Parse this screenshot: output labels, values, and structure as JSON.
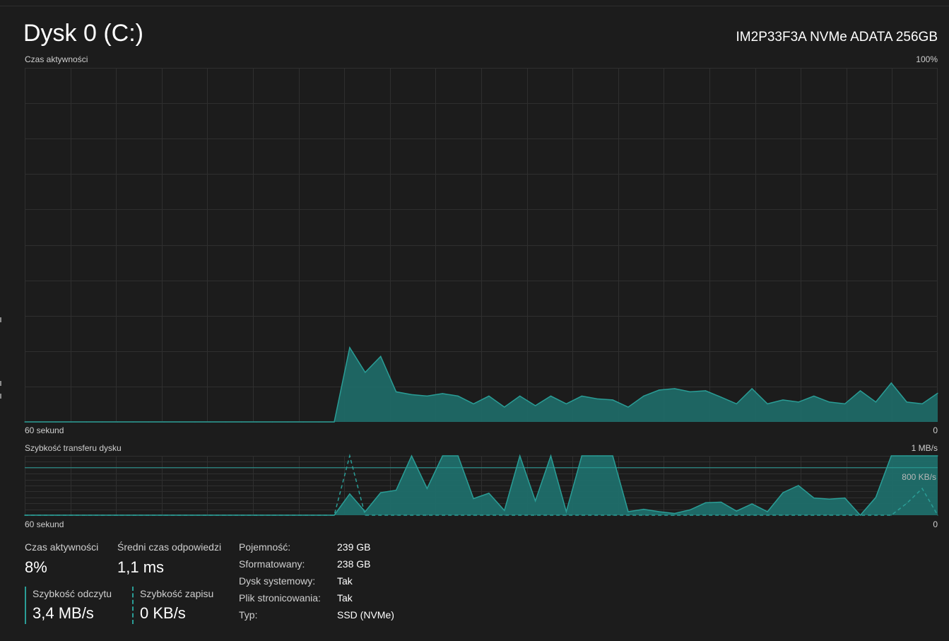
{
  "header": {
    "title": "Dysk 0 (C:)",
    "model": "IM2P33F3A NVMe ADATA 256GB"
  },
  "activity_chart": {
    "label": "Czas aktywności",
    "max_label": "100%",
    "x_left_label": "60 sekund",
    "x_right_label": "0"
  },
  "transfer_chart": {
    "label": "Szybkość transferu dysku",
    "max_label": "1 MB/s",
    "ref_label": "800 KB/s",
    "x_left_label": "60 sekund",
    "x_right_label": "0"
  },
  "stats": {
    "active_time": {
      "label": "Czas aktywności",
      "value": "8%"
    },
    "avg_response": {
      "label": "Średni czas odpowiedzi",
      "value": "1,1 ms"
    },
    "read_speed": {
      "label": "Szybkość odczytu",
      "value": "3,4 MB/s"
    },
    "write_speed": {
      "label": "Szybkość zapisu",
      "value": "0 KB/s"
    }
  },
  "properties": [
    {
      "label": "Pojemność:",
      "value": "239 GB"
    },
    {
      "label": "Sformatowany:",
      "value": "238 GB"
    },
    {
      "label": "Dysk systemowy:",
      "value": "Tak"
    },
    {
      "label": "Plik stronicowania:",
      "value": "Tak"
    },
    {
      "label": "Typ:",
      "value": "SSD (NVMe)"
    }
  ],
  "colors": {
    "accent": "#2a9d96",
    "fill": "#1f6e6a",
    "grid": "#2f2f2f",
    "background": "#1c1c1c"
  },
  "chart_data": [
    {
      "type": "area",
      "title": "Czas aktywności",
      "ylim": [
        0,
        100
      ],
      "xlim": [
        60,
        0
      ],
      "series": [
        {
          "values": [
            0,
            0,
            0,
            0,
            0,
            0,
            0,
            0,
            0,
            0,
            0,
            0,
            0,
            0,
            0,
            0,
            0,
            0,
            0,
            0,
            0,
            21,
            14,
            18.5,
            8.5,
            7.7,
            7.3,
            8,
            7.3,
            5.1,
            7.3,
            4.2,
            7.3,
            4.6,
            7.3,
            5.1,
            7.3,
            6.5,
            6.2,
            4.2,
            7.3,
            9,
            9.4,
            8.5,
            8.8,
            7,
            5.1,
            9.4,
            5.1,
            6.2,
            5.6,
            7.3,
            5.6,
            5.1,
            8.8,
            5.6,
            11,
            5.6,
            5.1,
            8.1
          ]
        }
      ]
    },
    {
      "type": "area",
      "title": "Szybkość transferu dysku",
      "ylim": [
        0,
        1000
      ],
      "xlim": [
        60,
        0
      ],
      "series": [
        {
          "name": "Szybkość odczytu",
          "values": [
            0,
            0,
            0,
            0,
            0,
            0,
            0,
            0,
            0,
            0,
            0,
            0,
            0,
            0,
            0,
            0,
            0,
            0,
            0,
            0,
            0,
            360,
            60,
            380,
            420,
            1000,
            450,
            1000,
            1000,
            280,
            370,
            80,
            1000,
            240,
            1000,
            60,
            1000,
            1000,
            1000,
            60,
            100,
            60,
            30,
            90,
            210,
            220,
            70,
            190,
            60,
            380,
            500,
            290,
            270,
            290,
            0,
            300,
            1000,
            1000,
            1000,
            1000
          ]
        },
        {
          "name": "Szybkość zapisu",
          "values": [
            0,
            0,
            0,
            0,
            0,
            0,
            0,
            0,
            0,
            0,
            0,
            0,
            0,
            0,
            0,
            0,
            0,
            0,
            0,
            0,
            0,
            1000,
            0,
            0,
            0,
            0,
            0,
            0,
            0,
            0,
            0,
            0,
            0,
            0,
            0,
            0,
            0,
            0,
            0,
            0,
            0,
            0,
            0,
            0,
            0,
            0,
            0,
            0,
            0,
            0,
            0,
            0,
            0,
            0,
            0,
            0,
            0,
            200,
            450,
            0
          ]
        }
      ]
    }
  ]
}
